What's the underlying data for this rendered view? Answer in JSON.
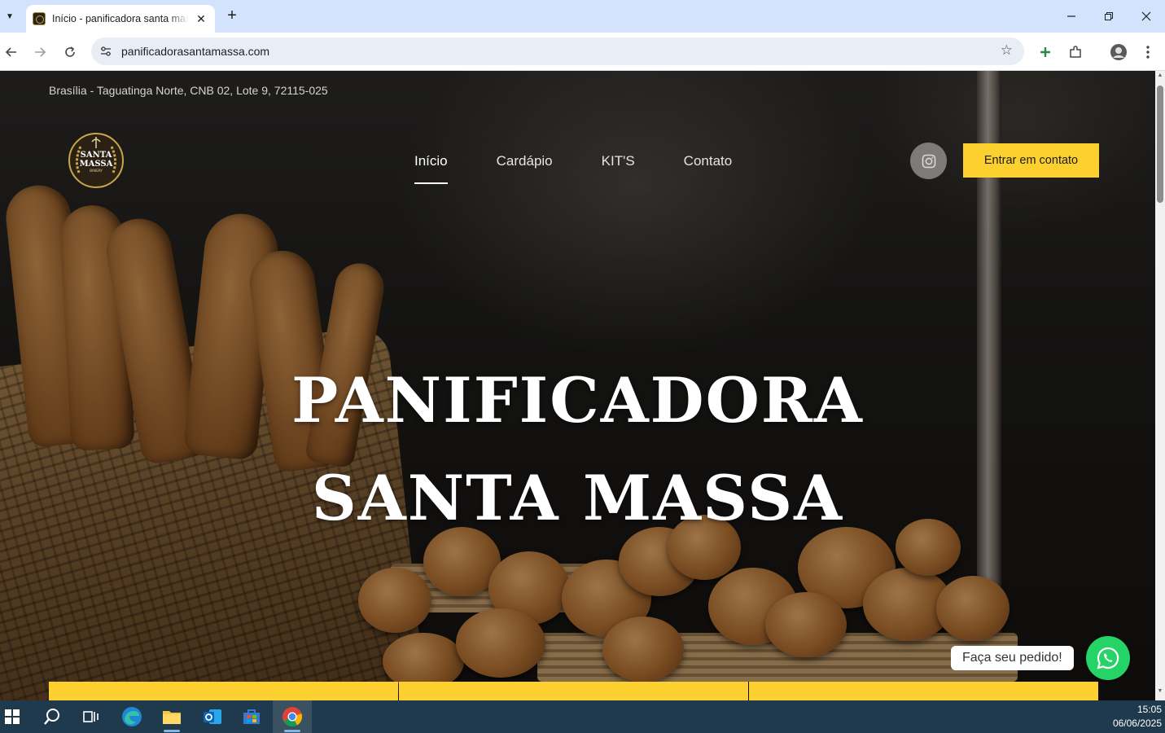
{
  "browser": {
    "tab_title": "Início - panificadora santa massa",
    "url": "panificadorasantamassa.com",
    "window_controls": {
      "minimize": "—",
      "restore": "❐",
      "close": "✕"
    }
  },
  "site": {
    "address": "Brasília - Taguatinga Norte, CNB 02, Lote 9, 72115-025",
    "logo_text": {
      "line1": "SANTA",
      "line2": "MASSA",
      "line3": "BAKERY"
    },
    "nav": [
      {
        "label": "Início",
        "active": true
      },
      {
        "label": "Cardápio",
        "active": false
      },
      {
        "label": "KIT'S",
        "active": false
      },
      {
        "label": "Contato",
        "active": false
      }
    ],
    "cta_label": "Entrar em contato",
    "hero_line1": "PANIFICADORA",
    "hero_line2": "SANTA MASSA",
    "whatsapp_label": "Faça seu pedido!",
    "accent_color": "#fcd12f",
    "whatsapp_color": "#25d366"
  },
  "taskbar": {
    "time": "15:05",
    "date": "06/06/2025",
    "apps": [
      "start-icon",
      "search-icon",
      "task-view-icon",
      "edge-icon",
      "file-explorer-icon",
      "outlook-icon",
      "store-icon",
      "chrome-icon"
    ]
  }
}
